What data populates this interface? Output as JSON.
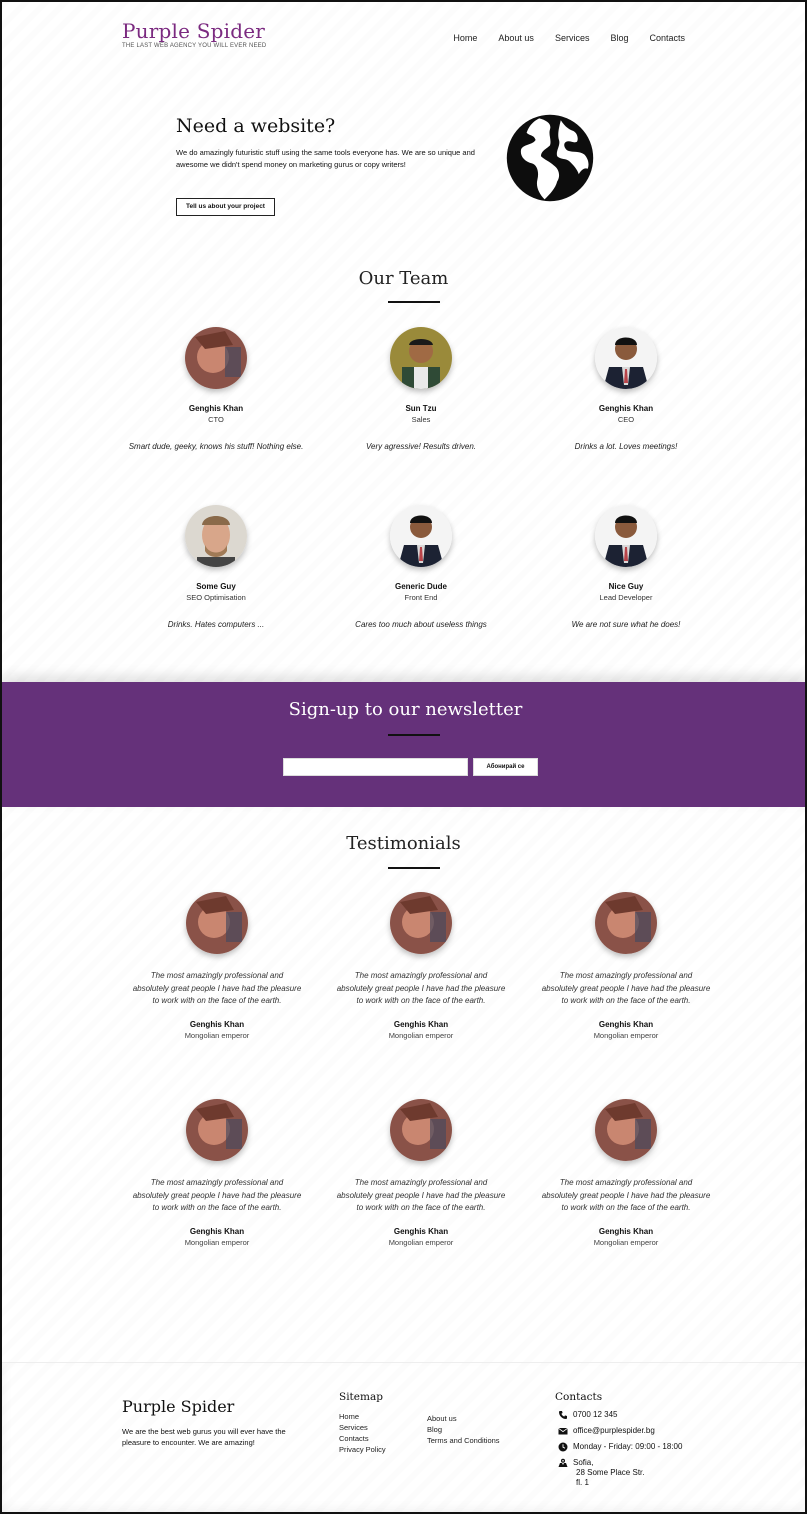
{
  "header": {
    "brand": "Purple Spider",
    "tagline": "THE LAST WEB AGENCY YOU WILL EVER NEED",
    "nav": [
      "Home",
      "About us",
      "Services",
      "Blog",
      "Contacts"
    ]
  },
  "hero": {
    "title": "Need a website?",
    "text": "We do amazingly futuristic stuff using the same tools everyone has. We are so unique and awesome we didn't spend money on marketing gurus or copy writers!",
    "button": "Tell us about your project"
  },
  "team": {
    "title": "Our Team",
    "members": [
      {
        "name": "Genghis Khan",
        "role": "CTO",
        "desc": "Smart dude, geeky, knows his stuff! Nothing else."
      },
      {
        "name": "Sun Tzu",
        "role": "Sales",
        "desc": "Very agressive! Results driven."
      },
      {
        "name": "Genghis Khan",
        "role": "CEO",
        "desc": "Drinks a lot. Loves meetings!"
      },
      {
        "name": "Some Guy",
        "role": "SEO Optimisation",
        "desc": "Drinks. Hates computers ..."
      },
      {
        "name": "Generic Dude",
        "role": "Front End",
        "desc": "Cares too much about useless things"
      },
      {
        "name": "Nice Guy",
        "role": "Lead Developer",
        "desc": "We are not sure what he does!"
      }
    ]
  },
  "newsletter": {
    "title": "Sign-up to our newsletter",
    "input_value": "",
    "button": "Абонирай се"
  },
  "testimonials": {
    "title": "Testimonials",
    "items": [
      {
        "quote": "The most amazingly professional and absolutely great people I have had the pleasure to work with on the face of the earth.",
        "name": "Genghis Khan",
        "role": "Mongolian emperor"
      },
      {
        "quote": "The most amazingly professional and absolutely great people I have had the pleasure to work with on the face of the earth.",
        "name": "Genghis Khan",
        "role": "Mongolian emperor"
      },
      {
        "quote": "The most amazingly professional and absolutely great people I have had the pleasure to work with on the face of the earth.",
        "name": "Genghis Khan",
        "role": "Mongolian emperor"
      },
      {
        "quote": "The most amazingly professional and absolutely great people I have had the pleasure to work with on the face of the earth.",
        "name": "Genghis Khan",
        "role": "Mongolian emperor"
      },
      {
        "quote": "The most amazingly professional and absolutely great people I have had the pleasure to work with on the face of the earth.",
        "name": "Genghis Khan",
        "role": "Mongolian emperor"
      },
      {
        "quote": "The most amazingly professional and absolutely great people I have had the pleasure to work with on the face of the earth.",
        "name": "Genghis Khan",
        "role": "Mongolian emperor"
      }
    ]
  },
  "footer": {
    "brand": "Purple Spider",
    "desc": "We are the best web gurus you will ever have the pleasure to encounter. We are amazing!",
    "sitemap_title": "Sitemap",
    "sitemap_col1": [
      "Home",
      "Services",
      "Contacts",
      "Privacy Policy"
    ],
    "sitemap_col2": [
      "About us",
      "Blog",
      "Terms and Conditions"
    ],
    "contacts_title": "Contacts",
    "phone": "0700 12 345",
    "email": "office@purplespider.bg",
    "hours": "Monday - Friday: 09:00 - 18:00",
    "address": [
      "Sofia,",
      "28 Some Place Str.",
      "fl. 1"
    ]
  },
  "colors": {
    "brand_purple": "#7b2a80",
    "newsletter_bg": "#65317a"
  },
  "icons": [
    "globe-icon",
    "phone-icon",
    "envelope-icon",
    "clock-icon",
    "map-icon"
  ]
}
